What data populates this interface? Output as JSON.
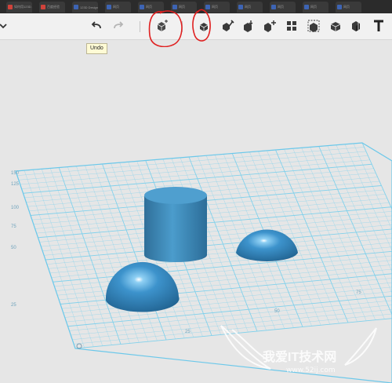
{
  "browser": {
    "tabs": [
      {
        "label": "如何用123D...",
        "favicon_color": "#d0433b"
      },
      {
        "label": "百度经验",
        "favicon_color": "#d0433b"
      },
      {
        "label": "123D Design",
        "favicon_color": "#3d64b4"
      },
      {
        "label": "网页",
        "favicon_color": "#3d64b4"
      },
      {
        "label": "网页",
        "favicon_color": "#3d64b4"
      },
      {
        "label": "网页",
        "favicon_color": "#3d64b4"
      },
      {
        "label": "网页",
        "favicon_color": "#3d64b4"
      },
      {
        "label": "网页",
        "favicon_color": "#3d64b4"
      },
      {
        "label": "网页",
        "favicon_color": "#3d64b4"
      },
      {
        "label": "网页",
        "favicon_color": "#3d64b4"
      },
      {
        "label": "网页",
        "favicon_color": "#3d64b4"
      }
    ]
  },
  "toolbar": {
    "tools": [
      {
        "icon": "chevron-down-icon"
      },
      {
        "icon": "undo-icon"
      },
      {
        "icon": "redo-icon"
      },
      {
        "icon": "primitives-icon"
      },
      {
        "icon": "sketch-icon"
      },
      {
        "icon": "construct-icon"
      },
      {
        "icon": "modify-icon"
      },
      {
        "icon": "pattern-icon"
      },
      {
        "icon": "group-icon"
      },
      {
        "icon": "combine-icon"
      },
      {
        "icon": "measure-icon"
      },
      {
        "icon": "text-icon"
      }
    ],
    "tooltip": "Undo",
    "annotation_color": "#e02020"
  },
  "scene": {
    "grid_labels_left": [
      "150",
      "125",
      "100",
      "75",
      "50",
      "25"
    ],
    "grid_labels_bottom": [
      "25",
      "50",
      "75"
    ],
    "objects": [
      "cylinder",
      "hemisphere",
      "hemisphere"
    ],
    "object_color": "#3d8ec2",
    "grid_color": "#7dd0ec"
  },
  "watermark": {
    "text": "我爱IT技术网",
    "url": "www.52ij.com"
  }
}
